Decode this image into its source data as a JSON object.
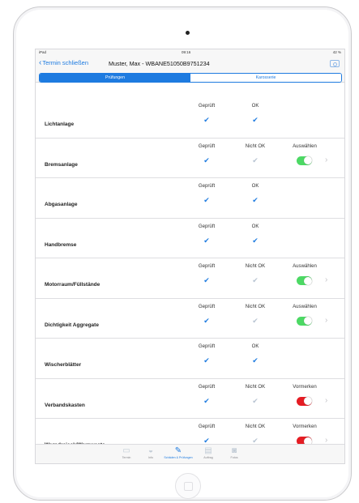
{
  "status": {
    "carrier": "iPad",
    "time": "09:16",
    "battery": "42 %"
  },
  "nav": {
    "back_label": "Termin schließen",
    "title": "Muster, Max - WBANE51050B9751234"
  },
  "segments": [
    "Prüfungen",
    "Karosserie"
  ],
  "rows": [
    {
      "label": "Lichtanlage",
      "h1": "Geprüft",
      "h2": "OK",
      "h3": "",
      "c1": "on",
      "c2": "on",
      "toggle": "",
      "arrow": false
    },
    {
      "label": "Bremsanlage",
      "h1": "Geprüft",
      "h2": "Nicht OK",
      "h3": "Auswählen",
      "c1": "on",
      "c2": "off",
      "toggle": "green",
      "arrow": true
    },
    {
      "label": "Abgasanlage",
      "h1": "Geprüft",
      "h2": "OK",
      "h3": "",
      "c1": "on",
      "c2": "on",
      "toggle": "",
      "arrow": false
    },
    {
      "label": "Handbremse",
      "h1": "Geprüft",
      "h2": "OK",
      "h3": "",
      "c1": "on",
      "c2": "on",
      "toggle": "",
      "arrow": false
    },
    {
      "label": "Motorraum/Füllstände",
      "h1": "Geprüft",
      "h2": "Nicht OK",
      "h3": "Auswählen",
      "c1": "on",
      "c2": "off",
      "toggle": "green",
      "arrow": true
    },
    {
      "label": "Dichtigkeit Aggregate",
      "h1": "Geprüft",
      "h2": "Nicht OK",
      "h3": "Auswählen",
      "c1": "on",
      "c2": "off",
      "toggle": "green",
      "arrow": true
    },
    {
      "label": "Wischerblätter",
      "h1": "Geprüft",
      "h2": "OK",
      "h3": "",
      "c1": "on",
      "c2": "on",
      "toggle": "",
      "arrow": false
    },
    {
      "label": "Verbandskasten",
      "h1": "Geprüft",
      "h2": "Nicht OK",
      "h3": "Vormerken",
      "c1": "on",
      "c2": "off",
      "toggle": "red",
      "arrow": true
    },
    {
      "label": "Warndreieck/Warnweste",
      "h1": "Geprüft",
      "h2": "Nicht OK",
      "h3": "Vormerken",
      "c1": "on",
      "c2": "off",
      "toggle": "red",
      "arrow": true
    }
  ],
  "tabs": [
    {
      "label": "Termin",
      "icon": "document-icon",
      "active": false
    },
    {
      "label": "Info",
      "icon": "car-icon",
      "active": false
    },
    {
      "label": "Schäden & Prüfungen",
      "icon": "wrench-icon",
      "active": true
    },
    {
      "label": "Auftrag",
      "icon": "printer-icon",
      "active": false
    },
    {
      "label": "Fotos",
      "icon": "camera-icon",
      "active": false
    }
  ],
  "colors": {
    "accent": "#1e7be0",
    "toggle_green": "#4cd964",
    "toggle_red": "#e51c23"
  }
}
